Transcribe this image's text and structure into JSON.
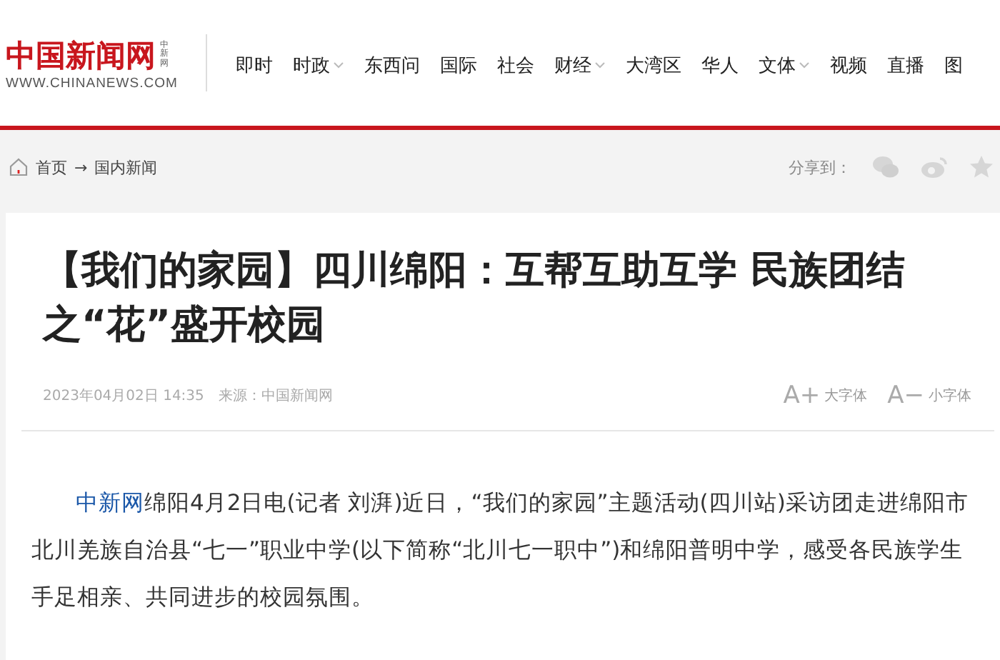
{
  "logo": {
    "title": "中国新闻网",
    "side": "中新网",
    "url": "WWW.CHINANEWS.COM"
  },
  "nav": [
    {
      "label": "即时",
      "dropdown": false
    },
    {
      "label": "时政",
      "dropdown": true
    },
    {
      "label": "东西问",
      "dropdown": false
    },
    {
      "label": "国际",
      "dropdown": false
    },
    {
      "label": "社会",
      "dropdown": false
    },
    {
      "label": "财经",
      "dropdown": true
    },
    {
      "label": "大湾区",
      "dropdown": false
    },
    {
      "label": "华人",
      "dropdown": false
    },
    {
      "label": "文体",
      "dropdown": true
    },
    {
      "label": "视频",
      "dropdown": false
    },
    {
      "label": "直播",
      "dropdown": false
    },
    {
      "label": "图",
      "dropdown": false
    }
  ],
  "breadcrumb": {
    "home": "首页",
    "arrow": "→",
    "section": "国内新闻"
  },
  "share": {
    "label": "分享到："
  },
  "article": {
    "title": "【我们的家园】四川绵阳：互帮互助互学 民族团结之“花”盛开校园",
    "date": "2023年04月02日 14:35",
    "source_label": "来源：",
    "source": "中国新闻网",
    "font_controls": [
      {
        "glyph": "A+",
        "label": "大字体"
      },
      {
        "glyph": "A−",
        "label": "小字体"
      }
    ],
    "lead_link": "中新网",
    "body": "绵阳4月2日电(记者 刘湃)近日，“我们的家园”主题活动(四川站)采访团走进绵阳市北川羌族自治县“七一”职业中学(以下简称“北川七一职中”)和绵阳普明中学，感受各民族学生手足相亲、共同进步的校园氛围。"
  }
}
